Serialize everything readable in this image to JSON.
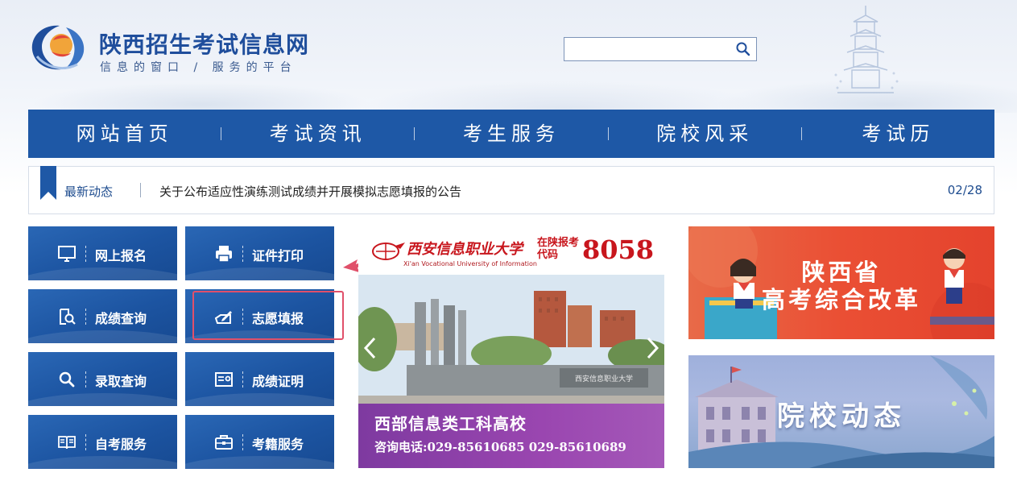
{
  "site": {
    "title": "陕西招生考试信息网",
    "slogan": "信息的窗口 / 服务的平台"
  },
  "search": {
    "placeholder": "",
    "value": ""
  },
  "nav": {
    "items": [
      {
        "label": "网站首页"
      },
      {
        "label": "考试资讯"
      },
      {
        "label": "考生服务"
      },
      {
        "label": "院校风采"
      },
      {
        "label": "考试历"
      }
    ]
  },
  "news": {
    "label": "最新动态",
    "headline": "关于公布适应性演练测试成绩并开展模拟志愿填报的公告",
    "date": "02/28"
  },
  "services": [
    {
      "label": "网上报名",
      "icon": "monitor-icon"
    },
    {
      "label": "证件打印",
      "icon": "printer-icon"
    },
    {
      "label": "成绩查询",
      "icon": "score-search-icon"
    },
    {
      "label": "志愿填报",
      "icon": "form-pen-icon"
    },
    {
      "label": "录取查询",
      "icon": "search-icon"
    },
    {
      "label": "成绩证明",
      "icon": "certificate-icon"
    },
    {
      "label": "自考服务",
      "icon": "book-icon"
    },
    {
      "label": "考籍服务",
      "icon": "briefcase-icon"
    }
  ],
  "banner": {
    "school_name": "西安信息职业大学",
    "school_en": "Xi'an Vocational University of Information",
    "apply_code_label": "在陕报考代码",
    "apply_code": "8058",
    "gate_sign": "西安信息职业大学",
    "slogan": "西部信息类工科高校",
    "phone": "咨询电话:029-85610685  029-85610689"
  },
  "promos": {
    "reform_line1": "陕西省",
    "reform_line2": "高考综合改革",
    "colleges": "院校动态"
  },
  "colors": {
    "nav_bg": "#1e58a6",
    "tile_bg": "#1c54a1",
    "highlight": "#e0506a",
    "promo_red": "#ea4f34",
    "banner_purple": "#8a3da6"
  }
}
